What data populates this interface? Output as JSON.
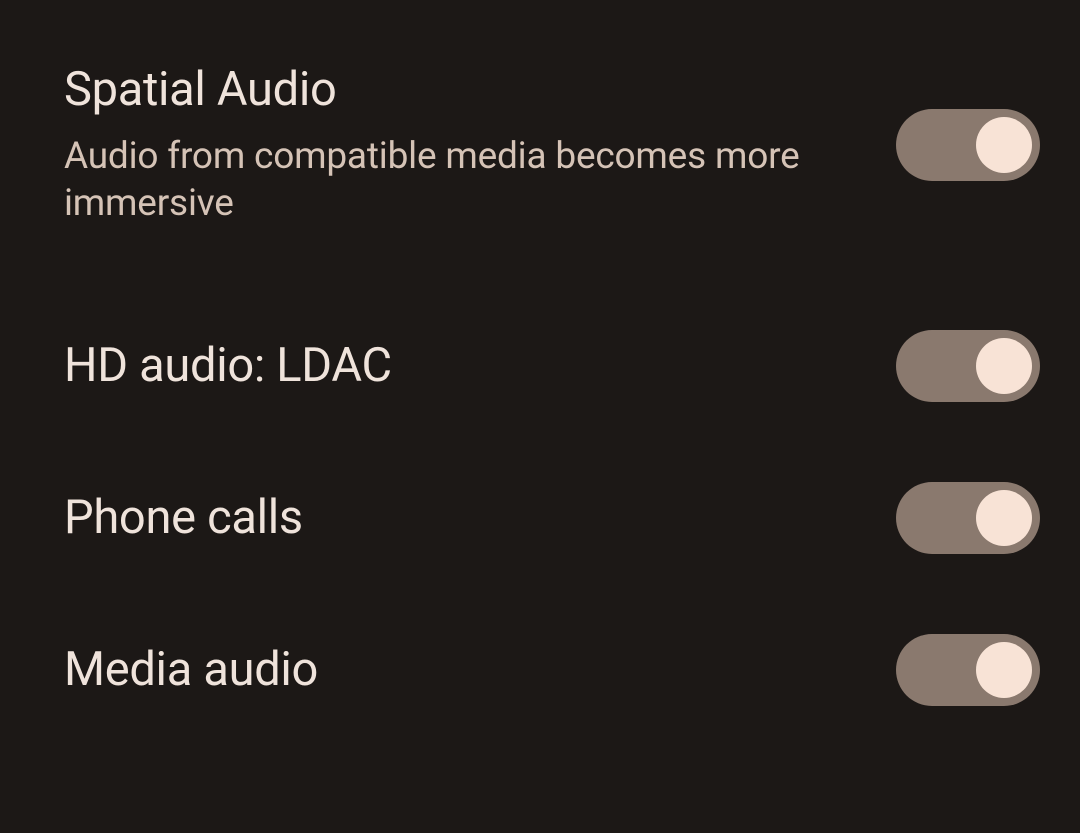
{
  "settings": [
    {
      "title": "Spatial Audio",
      "subtitle": "Audio from compatible media becomes more immersive",
      "enabled": true
    },
    {
      "title": "HD audio: LDAC",
      "subtitle": "",
      "enabled": true
    },
    {
      "title": "Phone calls",
      "subtitle": "",
      "enabled": true
    },
    {
      "title": "Media audio",
      "subtitle": "",
      "enabled": true
    }
  ]
}
